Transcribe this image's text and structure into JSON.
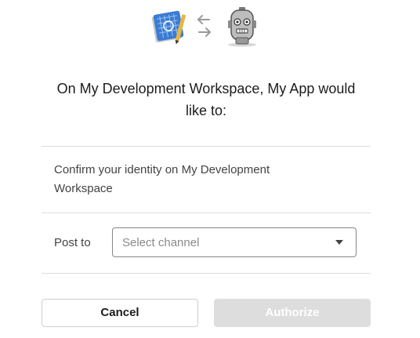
{
  "header": {
    "app_icon": "app-blueprint-icon",
    "exchange_icon": "exchange-arrows-icon",
    "bot_icon": "robot-icon",
    "title": "On My Development Workspace, My App would like to:"
  },
  "permissions": [
    {
      "text": "Confirm your identity on My Development Workspace"
    }
  ],
  "post_to": {
    "label": "Post to",
    "placeholder": "Select channel",
    "caret_icon": "caret-down-icon"
  },
  "actions": {
    "cancel_label": "Cancel",
    "authorize_label": "Authorize",
    "authorize_enabled": false
  },
  "colors": {
    "text": "#1d1c1d",
    "muted_text": "#454245",
    "divider": "#dddddd",
    "disabled_button": "#dddddd"
  }
}
